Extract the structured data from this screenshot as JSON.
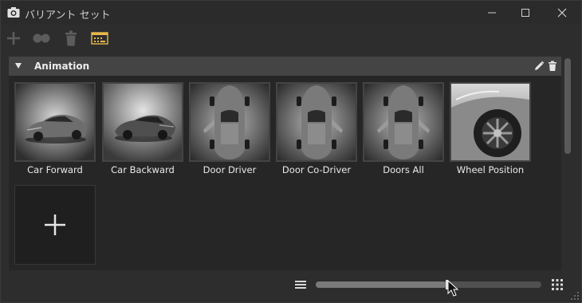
{
  "window": {
    "title": "バリアント セット"
  },
  "section": {
    "title": "Animation"
  },
  "variants": [
    {
      "label": "Car Forward",
      "kind": "car-front"
    },
    {
      "label": "Car Backward",
      "kind": "car-rear"
    },
    {
      "label": "Door Driver",
      "kind": "door-driver"
    },
    {
      "label": "Door Co-Driver",
      "kind": "door-codriver"
    },
    {
      "label": "Doors All",
      "kind": "doors-all"
    },
    {
      "label": "Wheel Position",
      "kind": "wheel"
    }
  ],
  "zoom_slider": {
    "value": 0.58
  },
  "colors": {
    "accent": "#e8b84b",
    "panel": "#262626",
    "header": "#444444"
  },
  "icons": {
    "app": "camera-icon",
    "add": "plus-icon",
    "group": "variant-group-icon",
    "delete": "trash-icon",
    "script": "script-icon",
    "edit": "pencil-icon",
    "list": "list-view-icon",
    "grid": "grid-view-icon"
  }
}
